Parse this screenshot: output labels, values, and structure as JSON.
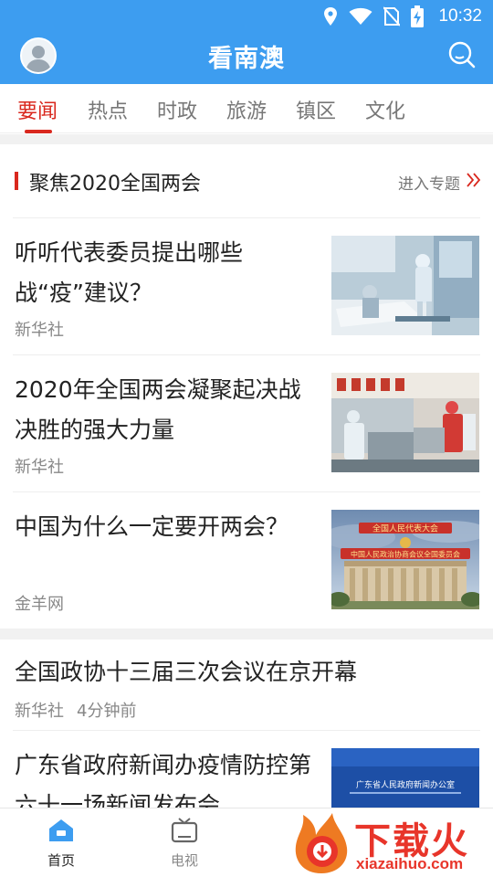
{
  "status": {
    "time": "10:32"
  },
  "app": {
    "title": "看南澳"
  },
  "tabs": [
    {
      "label": "要闻",
      "active": true
    },
    {
      "label": "热点"
    },
    {
      "label": "时政"
    },
    {
      "label": "旅游"
    },
    {
      "label": "镇区"
    },
    {
      "label": "文化"
    }
  ],
  "topic": {
    "title": "聚焦2020全国两会",
    "enter_label": "进入专题"
  },
  "news": [
    {
      "title": "听听代表委员提出哪些战“疫”建议？",
      "source": "新华社"
    },
    {
      "title": "2020年全国两会凝聚起决战决胜的强大力量",
      "source": "新华社"
    },
    {
      "title": "中国为什么一定要开两会？",
      "source": "金羊网"
    },
    {
      "title": "全国政协十三届三次会议在京开幕",
      "source": "新华社",
      "time": "4分钟前"
    },
    {
      "title": "广东省政府新闻办疫情防控第六十一场新闻发布会"
    }
  ],
  "thumb_text": {
    "banner_top": "全国人民代表大会",
    "banner_bottom": "中国人民政治协商会议全国委员会",
    "press_title": "广东省人民政府新闻办公室"
  },
  "bottom_nav": [
    {
      "label": "首页",
      "active": true
    },
    {
      "label": "电视"
    }
  ],
  "watermark": {
    "text": "下载火",
    "url": "xiazaihuo.com"
  },
  "colors": {
    "primary": "#3d9df0",
    "accent_red": "#d9281e",
    "muted": "#888888"
  }
}
